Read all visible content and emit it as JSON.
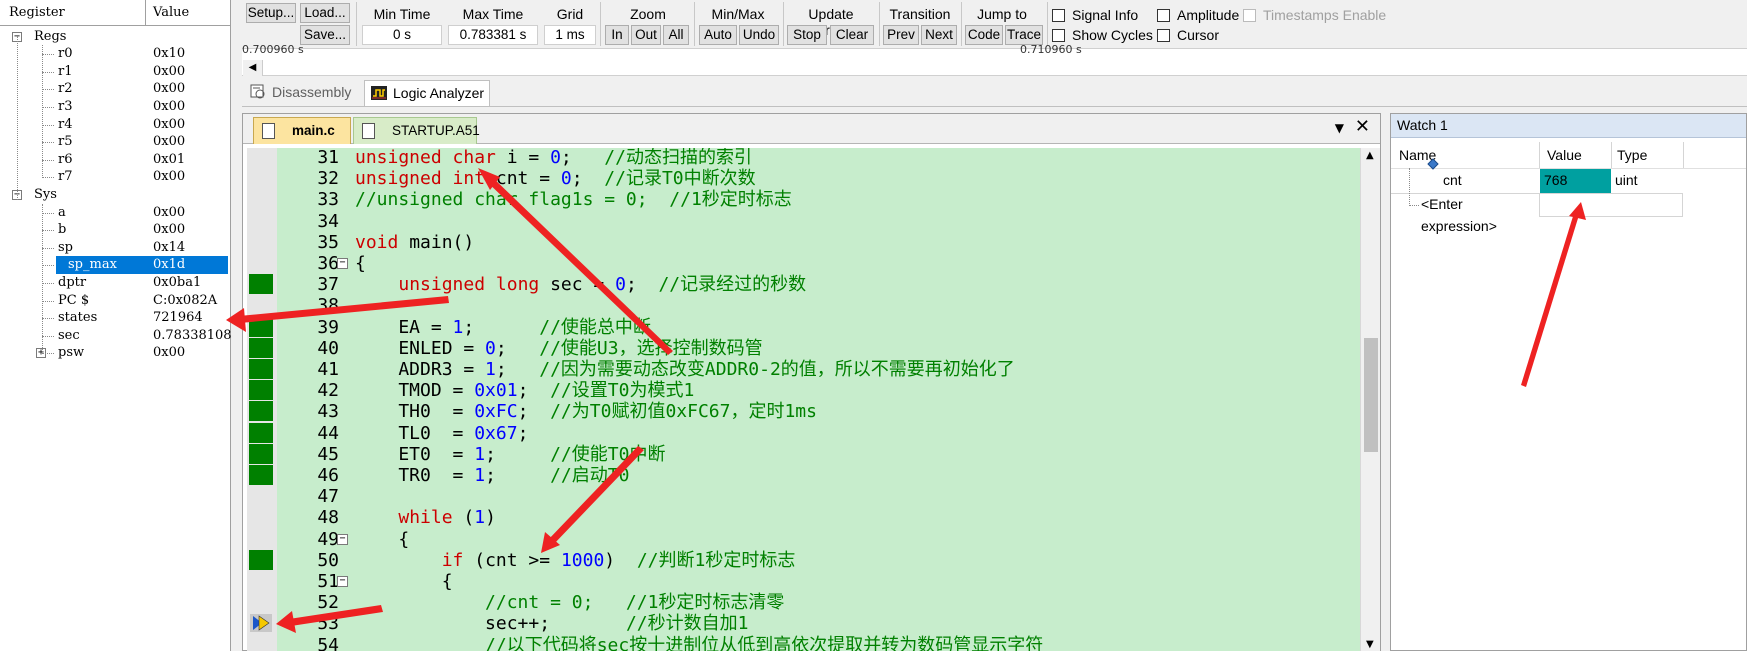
{
  "register_panel": {
    "col_register": "Register",
    "col_value": "Value",
    "groups": [
      {
        "name": "Regs",
        "expander": "−"
      },
      {
        "name": "Sys",
        "expander": "−"
      }
    ],
    "regs": [
      {
        "name": "r0",
        "value": "0x10"
      },
      {
        "name": "r1",
        "value": "0x00"
      },
      {
        "name": "r2",
        "value": "0x00"
      },
      {
        "name": "r3",
        "value": "0x00"
      },
      {
        "name": "r4",
        "value": "0x00"
      },
      {
        "name": "r5",
        "value": "0x00"
      },
      {
        "name": "r6",
        "value": "0x01"
      },
      {
        "name": "r7",
        "value": "0x00"
      }
    ],
    "sys": [
      {
        "name": "a",
        "value": "0x00"
      },
      {
        "name": "b",
        "value": "0x00"
      },
      {
        "name": "sp",
        "value": "0x14"
      },
      {
        "name": "sp_max",
        "value": "0x1d",
        "selected": true
      },
      {
        "name": "dptr",
        "value": "0x0ba1"
      },
      {
        "name": "PC  $",
        "value": "C:0x082A"
      },
      {
        "name": "states",
        "value": "721964"
      },
      {
        "name": "sec",
        "value": "0.78338108"
      },
      {
        "name": "psw",
        "value": "0x00",
        "expander": "+"
      }
    ]
  },
  "toolbar": {
    "setup": "Setup...",
    "load": "Load...",
    "save": "Save...",
    "min_time_label": "Min Time",
    "min_time_value": "0 s",
    "max_time_label": "Max Time",
    "max_time_value": "0.783381 s",
    "grid_label": "Grid",
    "grid_value": "1 ms",
    "zoom_label": "Zoom",
    "zoom_in": "In",
    "zoom_out": "Out",
    "zoom_all": "All",
    "minmax_label": "Min/Max",
    "auto": "Auto",
    "undo": "Undo",
    "update_label": "Update Screen",
    "stop": "Stop",
    "clear": "Clear",
    "transition_label": "Transition",
    "prev": "Prev",
    "next": "Next",
    "jumpto_label": "Jump to",
    "code": "Code",
    "trace": "Trace",
    "signal_info": "Signal Info",
    "amplitude": "Amplitude",
    "timestamps": "Timestamps Enable",
    "show_cycles": "Show Cycles",
    "cursor": "Cursor",
    "ts_left": "0.700960 s",
    "ts_right": "0.710960 s"
  },
  "view_tabs": {
    "disassembly": "Disassembly",
    "logic_analyzer": "Logic Analyzer"
  },
  "editor_tabs": {
    "main": "main.c",
    "startup": "STARTUP.A51"
  },
  "watch": {
    "title": "Watch 1",
    "col_name": "Name",
    "col_value": "Value",
    "col_type": "Type",
    "rows": [
      {
        "name": "cnt",
        "value": "768",
        "type": "uint"
      }
    ],
    "enter_expression": "<Enter expression>"
  },
  "code_lines": [
    {
      "n": "31",
      "cov": false,
      "fold": "",
      "html": "<span class='kw'>unsigned char</span> i = <span class='num'>0</span>;   <span class='cm'>//动态扫描的索引</span>"
    },
    {
      "n": "32",
      "cov": false,
      "fold": "",
      "html": "<span class='kw'>unsigned int</span> cnt = <span class='num'>0</span>;  <span class='cm'>//记录T0中断次数</span>"
    },
    {
      "n": "33",
      "cov": false,
      "fold": "",
      "html": "<span class='cm'>//unsigned char flag1s = 0;  //1秒定时标志</span>"
    },
    {
      "n": "34",
      "cov": false,
      "fold": "",
      "html": ""
    },
    {
      "n": "35",
      "cov": false,
      "fold": "",
      "html": "<span class='kw'>void</span> main()"
    },
    {
      "n": "36",
      "cov": false,
      "fold": "−",
      "html": "{"
    },
    {
      "n": "37",
      "cov": true,
      "fold": "",
      "html": "    <span class='kw'>unsigned long</span> sec = <span class='num'>0</span>;  <span class='cm'>//记录经过的秒数</span>"
    },
    {
      "n": "38",
      "cov": false,
      "fold": "",
      "html": ""
    },
    {
      "n": "39",
      "cov": true,
      "fold": "",
      "html": "    EA = <span class='num'>1</span>;      <span class='cm'>//使能总中断</span>"
    },
    {
      "n": "40",
      "cov": true,
      "fold": "",
      "html": "    ENLED = <span class='num'>0</span>;   <span class='cm'>//使能U3，选择控制数码管</span>"
    },
    {
      "n": "41",
      "cov": true,
      "fold": "",
      "html": "    ADDR3 = <span class='num'>1</span>;   <span class='cm'>//因为需要动态改变ADDR0-2的值，所以不需要再初始化了</span>"
    },
    {
      "n": "42",
      "cov": true,
      "fold": "",
      "html": "    TMOD = <span class='num'>0x01</span>;  <span class='cm'>//设置T0为模式1</span>"
    },
    {
      "n": "43",
      "cov": true,
      "fold": "",
      "html": "    TH0  = <span class='num'>0xFC</span>;  <span class='cm'>//为T0赋初值0xFC67，定时1ms</span>"
    },
    {
      "n": "44",
      "cov": true,
      "fold": "",
      "html": "    TL0  = <span class='num'>0x67</span>;"
    },
    {
      "n": "45",
      "cov": true,
      "fold": "",
      "html": "    ET0  = <span class='num'>1</span>;     <span class='cm'>//使能T0中断</span>"
    },
    {
      "n": "46",
      "cov": true,
      "fold": "",
      "html": "    TR0  = <span class='num'>1</span>;     <span class='cm'>//启动T0</span>"
    },
    {
      "n": "47",
      "cov": false,
      "fold": "",
      "html": ""
    },
    {
      "n": "48",
      "cov": false,
      "fold": "",
      "html": "    <span class='kw'>while</span> (<span class='num'>1</span>)"
    },
    {
      "n": "49",
      "cov": false,
      "fold": "−",
      "html": "    {"
    },
    {
      "n": "50",
      "cov": true,
      "fold": "",
      "html": "        <span class='kw'>if</span> (cnt &gt;= <span class='num'>1000</span>)  <span class='cm'>//判断1秒定时标志</span>"
    },
    {
      "n": "51",
      "cov": false,
      "fold": "−",
      "html": "        {"
    },
    {
      "n": "52",
      "cov": false,
      "fold": "",
      "html": "            <span class='cm'>//cnt = 0;   //1秒定时标志清零</span>"
    },
    {
      "n": "53",
      "cov": false,
      "fold": "",
      "html": "            sec++;       <span class='cm'>//秒计数自加1</span>",
      "pc": true
    },
    {
      "n": "54",
      "cov": false,
      "fold": "",
      "html": "            <span class='cm'>//以下代码将sec按十进制位从低到高依次提取并转为数码管显示字符</span>"
    }
  ],
  "colors": {
    "code_bg": "#c7edcc",
    "coverage": "#008000",
    "keyword": "#cc0000",
    "comment": "#008000",
    "number": "#0000ff",
    "selection": "#0078d7",
    "watch_value_bg": "#00a0a0",
    "arrow": "#ee2222"
  }
}
